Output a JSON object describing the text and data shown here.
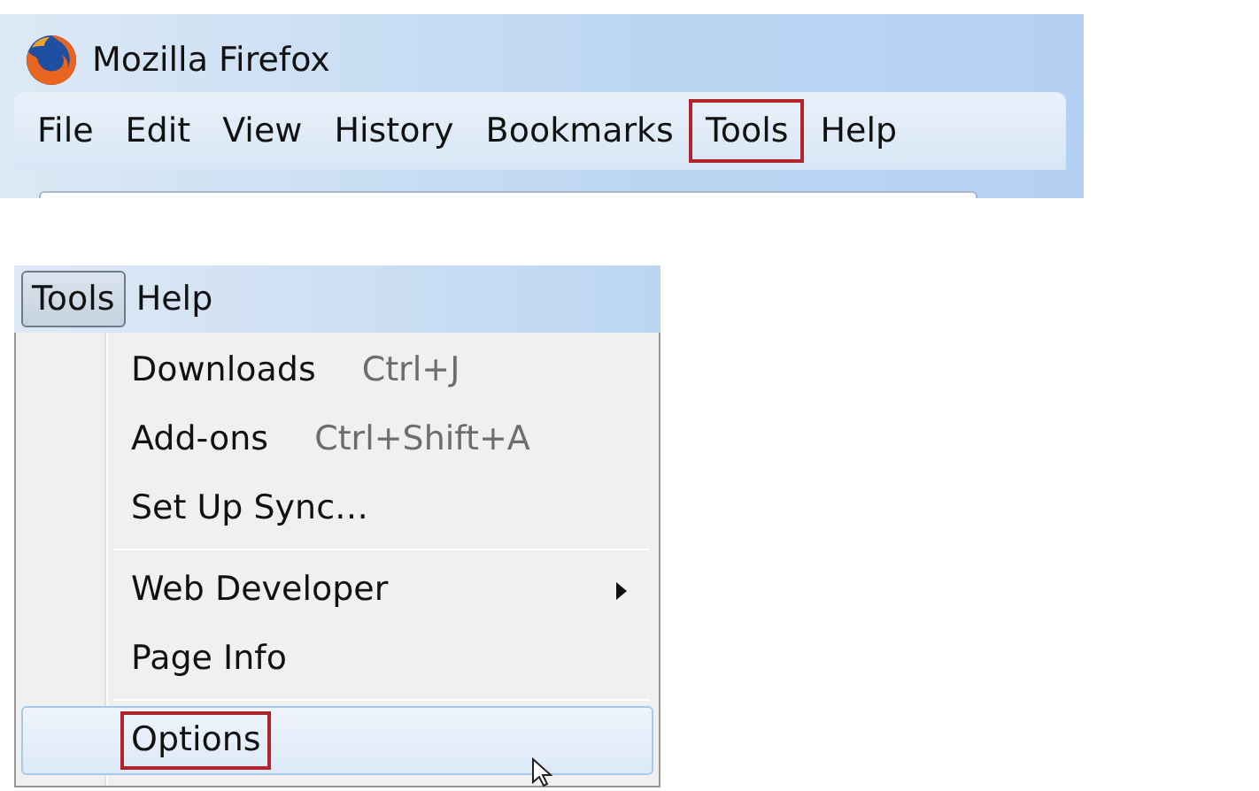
{
  "firefox_window": {
    "title": "Mozilla Firefox",
    "menu": [
      {
        "label": "File",
        "annotated": false
      },
      {
        "label": "Edit",
        "annotated": false
      },
      {
        "label": "View",
        "annotated": false
      },
      {
        "label": "History",
        "annotated": false
      },
      {
        "label": "Bookmarks",
        "annotated": false
      },
      {
        "label": "Tools",
        "annotated": true
      },
      {
        "label": "Help",
        "annotated": false
      }
    ]
  },
  "menu_detail": {
    "menu": [
      {
        "label": "Tools",
        "selected": true
      },
      {
        "label": "Help",
        "selected": false
      }
    ],
    "dropdown": [
      {
        "kind": "item",
        "label": "Downloads",
        "shortcut": "Ctrl+J",
        "submenu": false,
        "selected": false,
        "annotated": false
      },
      {
        "kind": "item",
        "label": "Add-ons",
        "shortcut": "Ctrl+Shift+A",
        "submenu": false,
        "selected": false,
        "annotated": false
      },
      {
        "kind": "item",
        "label": "Set Up Sync…",
        "submenu": false,
        "selected": false,
        "annotated": false
      },
      {
        "kind": "separator"
      },
      {
        "kind": "item",
        "label": "Web Developer",
        "submenu": true,
        "selected": false,
        "annotated": false
      },
      {
        "kind": "item",
        "label": "Page Info",
        "submenu": false,
        "selected": false,
        "annotated": false
      },
      {
        "kind": "separator"
      },
      {
        "kind": "item",
        "label": "Options",
        "submenu": false,
        "selected": true,
        "annotated": true
      }
    ]
  }
}
